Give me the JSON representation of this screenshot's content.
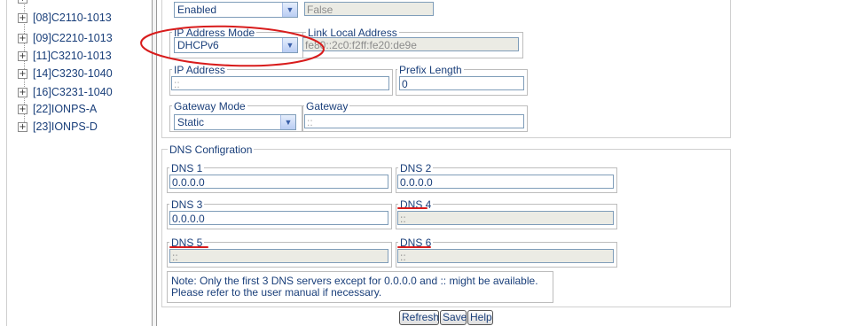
{
  "tree": {
    "items": [
      {
        "label": "[08]C2110-1013"
      },
      {
        "label": "[09]C2210-1013"
      },
      {
        "label": "[11]C3210-1013"
      },
      {
        "label": "[14]C3230-1040"
      },
      {
        "label": "[16]C3231-1040"
      },
      {
        "label": "[22]IONPS-A"
      },
      {
        "label": "[23]IONPS-D"
      }
    ],
    "expander_glyph": "+"
  },
  "ip": {
    "enabled_select": "Enabled",
    "false_value": "False",
    "mode_label": "IP Address Mode",
    "mode_value": "DHCPv6",
    "link_local_label": "Link Local Address",
    "link_local_value": "fe80::2c0:f2ff:fe20:de9e",
    "address_label": "IP Address",
    "address_value": "::",
    "prefix_label": "Prefix Length",
    "prefix_value": "0",
    "gateway_mode_label": "Gateway Mode",
    "gateway_mode_value": "Static",
    "gateway_label": "Gateway",
    "gateway_value": "::"
  },
  "dns": {
    "legend": "DNS Configration",
    "dns1_label": "DNS 1",
    "dns1_value": "0.0.0.0",
    "dns2_label": "DNS 2",
    "dns2_value": "0.0.0.0",
    "dns3_label": "DNS 3",
    "dns3_value": "0.0.0.0",
    "dns4_label": "DNS 4",
    "dns4_value": "::",
    "dns5_label": "DNS 5",
    "dns5_value": "::",
    "dns6_label": "DNS 6",
    "dns6_value": "::",
    "note_line1": "Note: Only the first 3 DNS servers except for 0.0.0.0 and :: might be available.",
    "note_line2": "Please refer to the user manual if necessary."
  },
  "buttons": {
    "refresh": "Refresh",
    "save": "Save",
    "help": "Help"
  },
  "icons": {
    "select_arrow": "chevron-down-icon"
  },
  "colors": {
    "annotation_red": "#d81c1c",
    "label_blue": "#1a3f7a",
    "disabled_bg": "#ebebe4"
  }
}
